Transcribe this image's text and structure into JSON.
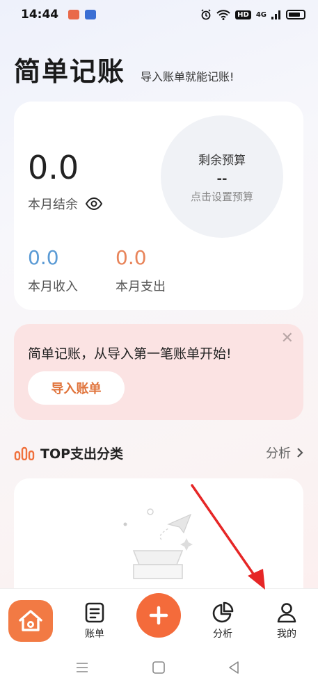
{
  "status_bar": {
    "time": "14:44",
    "network": "4G",
    "hd": "HD"
  },
  "header": {
    "title": "简单记账",
    "subtitle": "导入账单就能记账!"
  },
  "summary": {
    "balance_value": "0.0",
    "balance_label": "本月结余",
    "budget_title": "剩余预算",
    "budget_value": "--",
    "budget_link": "点击设置预算",
    "income_value": "0.0",
    "income_label": "本月收入",
    "expense_value": "0.0",
    "expense_label": "本月支出"
  },
  "banner": {
    "text": "简单记账，从导入第一笔账单开始!",
    "button": "导入账单"
  },
  "top_section": {
    "title": "TOP支出分类",
    "link": "分析"
  },
  "tabbar": {
    "bills": "账单",
    "analysis": "分析",
    "mine": "我的"
  },
  "colors": {
    "accent": "#f46b3b",
    "income": "#5b9bd5",
    "expense": "#e8845a",
    "banner_bg": "#fbe3e3"
  }
}
